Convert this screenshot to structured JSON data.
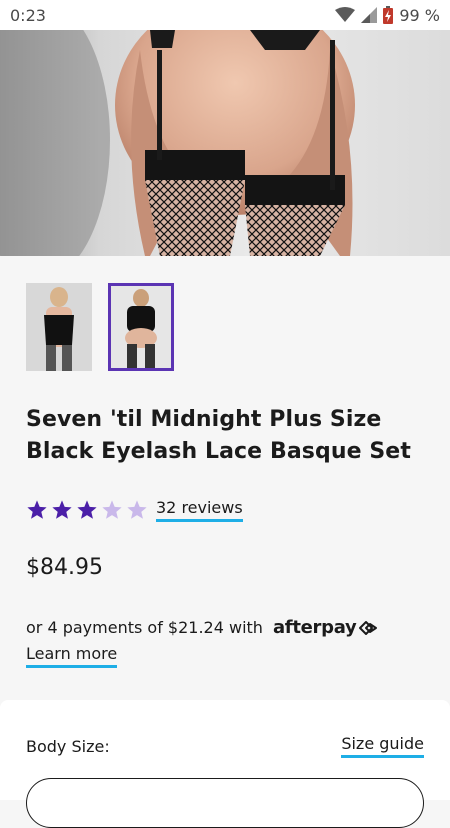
{
  "status_bar": {
    "time": "0:23",
    "battery": "99 %",
    "icons": [
      "wifi-icon",
      "cellular-signal-icon",
      "battery-icon"
    ]
  },
  "gallery": {
    "main_image": "product-photo-back-view",
    "thumbnails": [
      "front-view-thumbnail",
      "back-view-thumbnail"
    ],
    "selected_index": 1
  },
  "product": {
    "title": "Seven 'til Midnight Plus Size Black Eyelash Lace Basque Set",
    "rating": 3,
    "rating_max": 5,
    "reviews_label": "32 reviews",
    "price": "$84.95"
  },
  "afterpay": {
    "text": "or 4 payments of $21.24 with",
    "logo_text": "afterpay",
    "learn_more": "Learn more"
  },
  "options": {
    "body_size_label": "Body Size:",
    "size_guide": "Size guide"
  },
  "colors": {
    "star_filled": "#4b1fa8",
    "star_empty": "#c9b8ea",
    "link_underline": "#1eaee6",
    "thumb_selected_border": "#5b34b3"
  }
}
